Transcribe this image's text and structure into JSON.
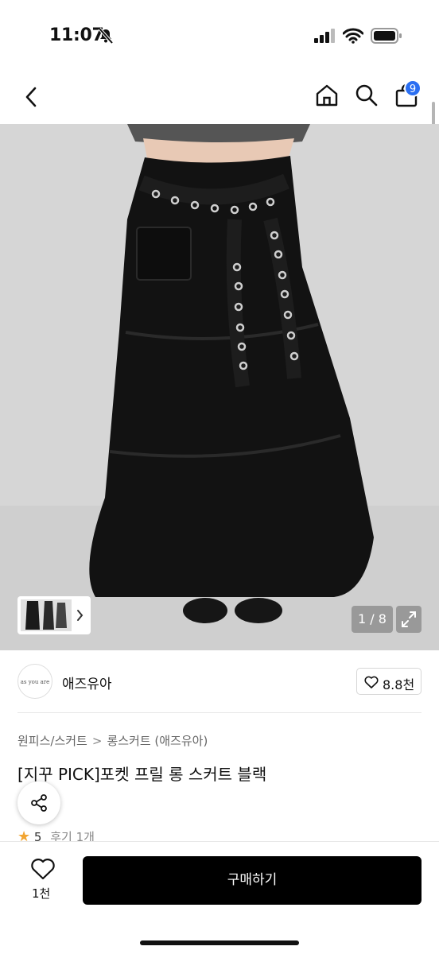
{
  "status_bar": {
    "time": "11:07"
  },
  "nav": {
    "cart_count": "9"
  },
  "gallery": {
    "counter": "1 / 8"
  },
  "shop": {
    "logo_text": "as you are",
    "name": "애즈유아",
    "likes": "8.8천"
  },
  "breadcrumb": {
    "level1": "원피스/스커트",
    "separator": ">",
    "level2": "롱스커트 (애즈유아)"
  },
  "product": {
    "title": "[지꾸 PICK]포켓 프릴 롱 스커트 블랙"
  },
  "rating": {
    "score": "5",
    "reviews": "후기 1개"
  },
  "bottom_bar": {
    "wish_count": "1천",
    "buy_label": "구매하기"
  },
  "colors": {
    "accent_badge": "#2b6ff2",
    "buy_button": "#000000",
    "star": "#f2a532"
  }
}
